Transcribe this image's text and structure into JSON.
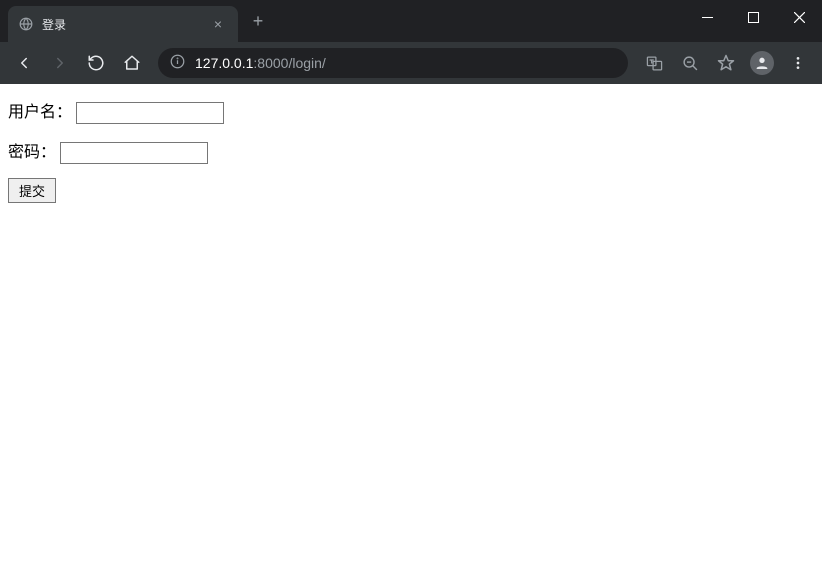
{
  "window": {
    "tab_title": "登录",
    "new_tab_icon": "+",
    "close_tab_icon": "×"
  },
  "address_bar": {
    "host": "127.0.0.1",
    "port": ":8000",
    "path": "/login/"
  },
  "page": {
    "username_label": "用户名：",
    "password_label": "密码：",
    "username_value": "",
    "password_value": "",
    "submit_label": "提交"
  }
}
